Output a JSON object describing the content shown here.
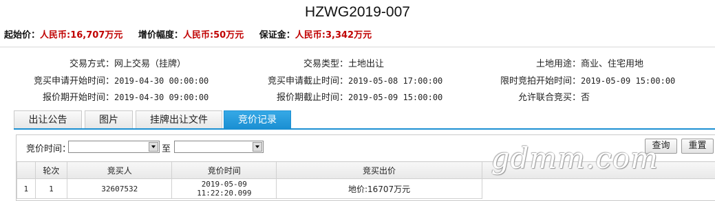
{
  "title": "HZWG2019-007",
  "pricebar": {
    "start_label": "起始价：",
    "start_value": "人民币:16,707万元",
    "increment_label": "增价幅度：",
    "increment_value": "人民币:50万元",
    "deposit_label": "保证金：",
    "deposit_value": "人民币:3,342万元"
  },
  "info": {
    "trade_mode_label": "交易方式：",
    "trade_mode": "网上交易（挂牌）",
    "trade_type_label": "交易类型：",
    "trade_type": "土地出让",
    "land_use_label": "土地用途：",
    "land_use": "商业、住宅用地",
    "apply_start_label": "竞买申请开始时间：",
    "apply_start": "2019-04-30 00:00:00",
    "apply_end_label": "竞买申请截止时间：",
    "apply_end": "2019-05-08 17:00:00",
    "timed_start_label": "限时竞拍开始时间：",
    "timed_start": "2019-05-09 15:00:00",
    "quote_start_label": "报价期开始时间：",
    "quote_start": "2019-04-30 09:00:00",
    "quote_end_label": "报价期截止时间：",
    "quote_end": "2019-05-09 15:00:00",
    "joint_label": "允许联合竞买：",
    "joint": "否"
  },
  "tabs": [
    {
      "label": "出让公告"
    },
    {
      "label": "图片"
    },
    {
      "label": "挂牌出让文件"
    },
    {
      "label": "竞价记录",
      "active": true
    }
  ],
  "search": {
    "time_label": "竞价时间：",
    "to_label": "至",
    "from_value": "",
    "to_value": "",
    "query_button": "查询",
    "reset_button": "重置"
  },
  "table": {
    "headers": [
      "",
      "轮次",
      "竞买人",
      "竞价时间",
      "竞买出价"
    ],
    "rows": [
      [
        "1",
        "1",
        "32607532",
        "2019-05-09 11:22:20.099",
        "地价:16707万元"
      ]
    ]
  },
  "watermark": "gdmm.com"
}
